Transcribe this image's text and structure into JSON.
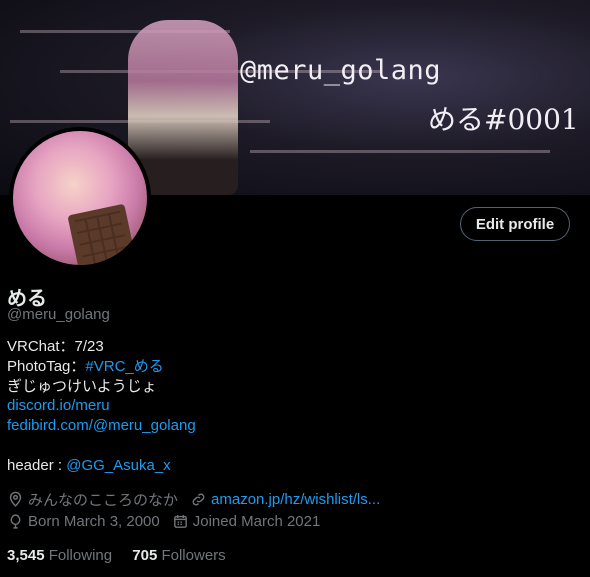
{
  "banner": {
    "handle_art": "@meru_golang",
    "tag_art": "める#0001"
  },
  "profile": {
    "edit_label": "Edit profile",
    "name": "める",
    "handle": "@meru_golang"
  },
  "bio": {
    "vrchat": "VRChat：7/23",
    "phototag_prefix": "PhotoTag：",
    "phototag_link": "#VRC_める",
    "line3": "ぎじゅつけいようじょ",
    "link1": "discord.io/meru",
    "link2": "fedibird.com/@meru_golang",
    "header_prefix": "header : ",
    "header_link": "@GG_Asuka_x"
  },
  "meta": {
    "location": "みんなのこころのなか",
    "website": "amazon.jp/hz/wishlist/ls...",
    "born": "Born March 3, 2000",
    "joined": "Joined March 2021"
  },
  "stats": {
    "following_count": "3,545",
    "following_label": "Following",
    "followers_count": "705",
    "followers_label": "Followers"
  },
  "icons": [
    "location-icon",
    "link-icon",
    "birthday-icon",
    "calendar-icon"
  ]
}
